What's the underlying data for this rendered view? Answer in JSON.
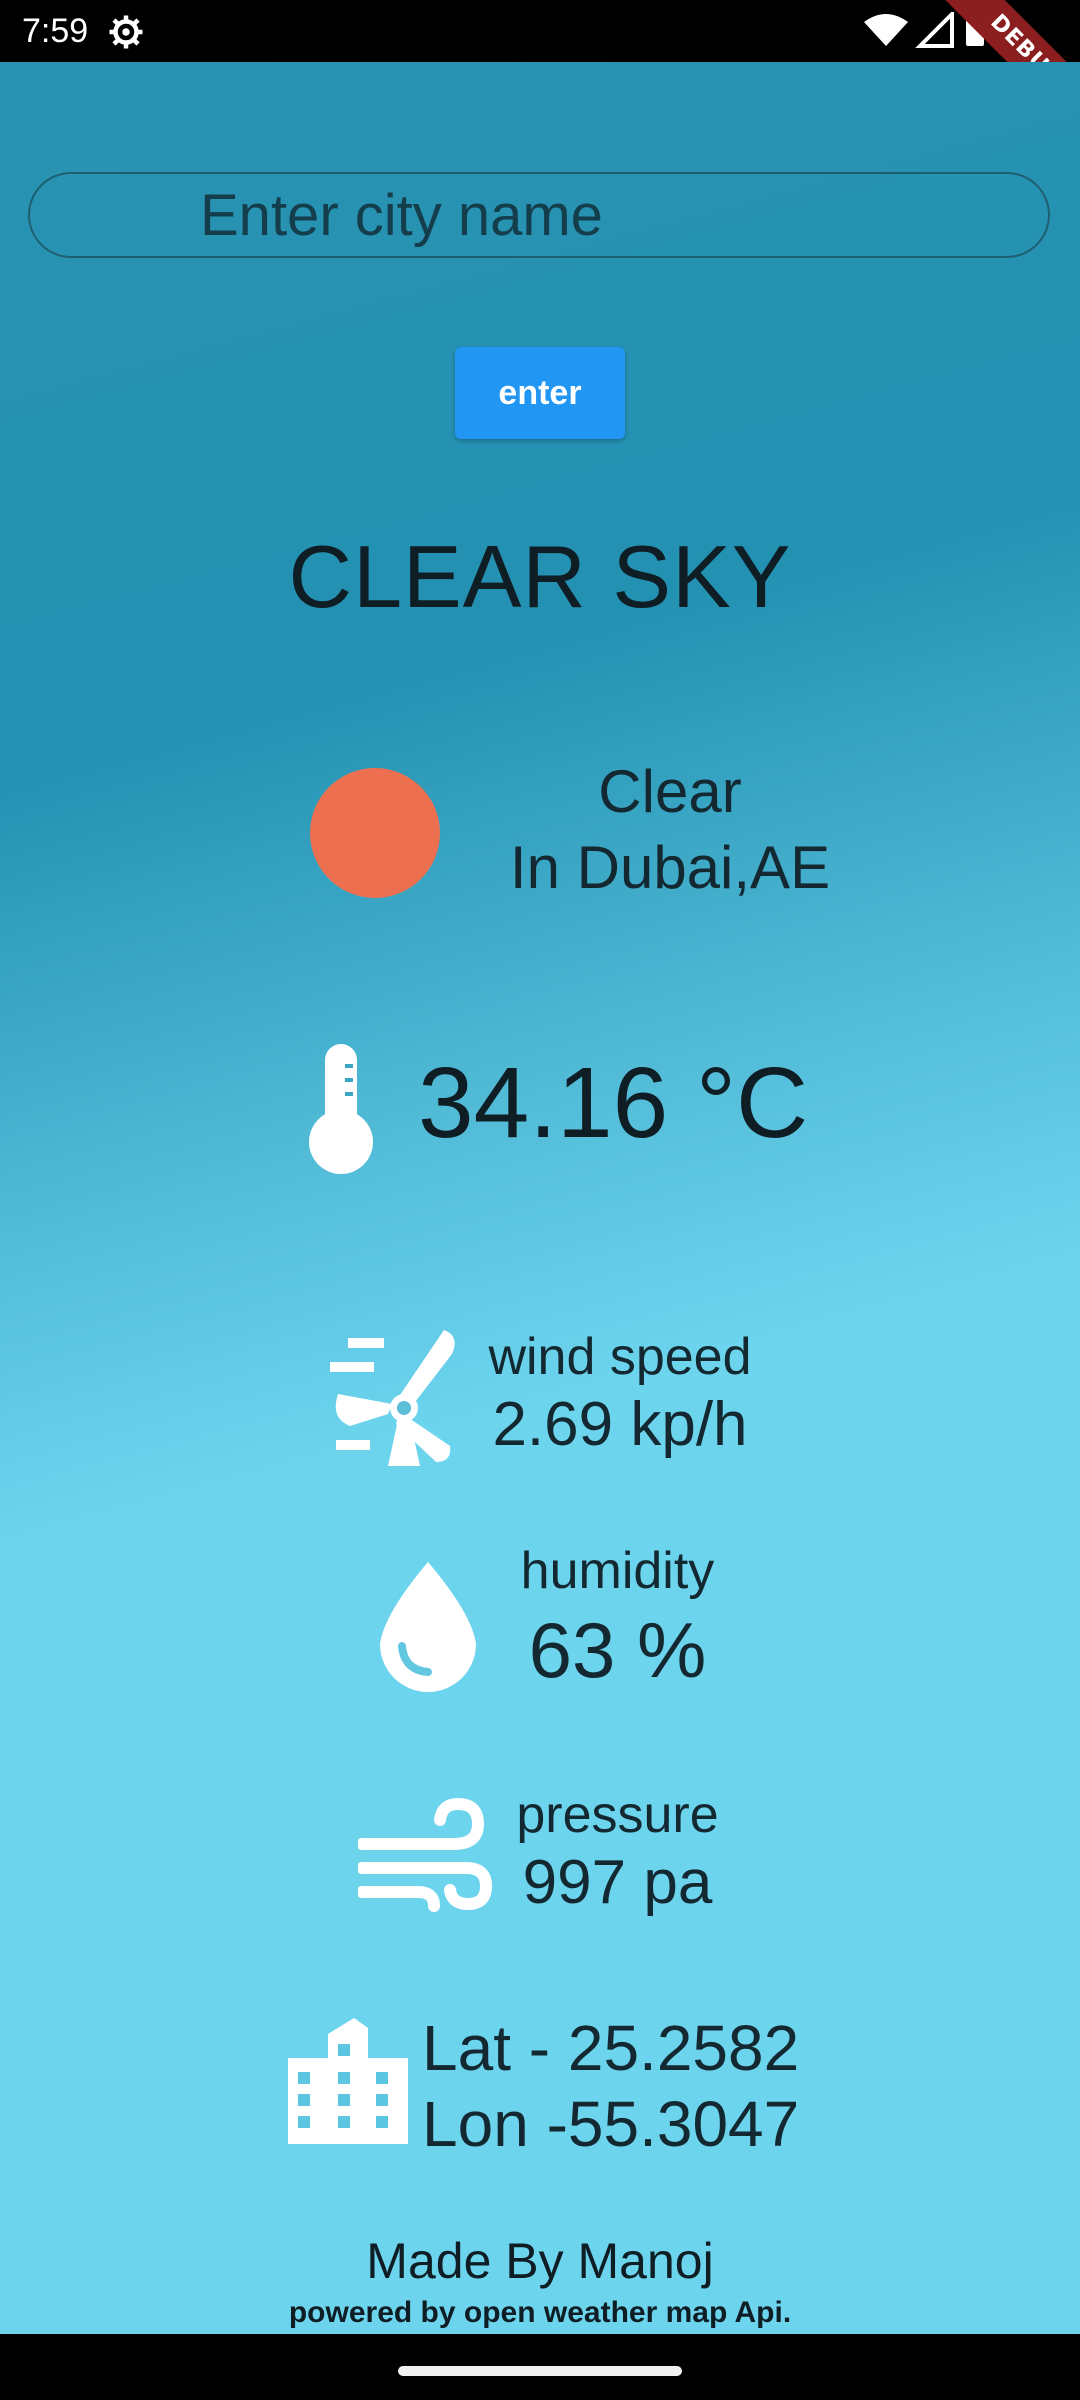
{
  "status_bar": {
    "time": "7:59",
    "icons": [
      "gear-icon",
      "wifi-icon",
      "signal-icon",
      "battery-icon"
    ]
  },
  "debug_banner": "DEBUG",
  "search": {
    "placeholder": "Enter city name",
    "value": ""
  },
  "enter_button": "enter",
  "weather": {
    "title": "CLEAR SKY",
    "main": "Clear",
    "location": "In Dubai,AE",
    "temperature": "34.16 °C",
    "wind_label": "wind speed",
    "wind_value": "2.69 kp/h",
    "humidity_label": "humidity",
    "humidity_value": "63 %",
    "pressure_label": "pressure",
    "pressure_value": "997 pa",
    "lat": "Lat - 25.2582",
    "lon": "Lon -55.3047"
  },
  "footer": {
    "made_by": "Made By Manoj",
    "powered_by": "powered by open weather map Api."
  },
  "colors": {
    "accent": "#2196f3",
    "sun": "#ec7050",
    "bg_top": "#2391b2",
    "bg_bottom": "#6dd4ee"
  }
}
